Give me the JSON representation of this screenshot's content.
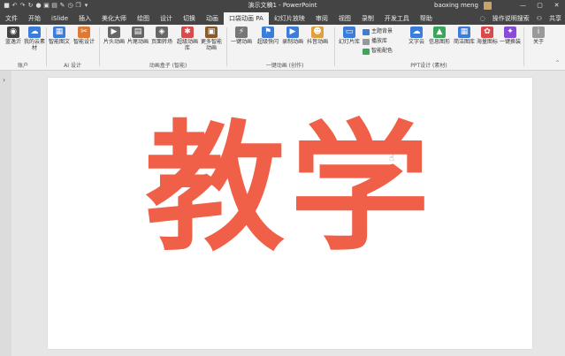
{
  "window": {
    "title": "演示文稿1 - PowerPoint",
    "user_name": "baoxing meng",
    "controls": [
      "—",
      "▢",
      "✕"
    ]
  },
  "tabs": [
    "文件",
    "开始",
    "iSlide",
    "插入",
    "美化大师",
    "绘图",
    "设计",
    "切换",
    "动画",
    "口袋动画 PA",
    "幻灯片放映",
    "审阅",
    "视图",
    "录制",
    "开发工具",
    "帮助"
  ],
  "active_tab": "口袋动画 PA",
  "tabs_right": {
    "search": "操作说明搜索",
    "share": "共享"
  },
  "ribbon": {
    "buttons": [
      {
        "label": "蓝逸沂",
        "icon": "avatar-icon",
        "color": "#444444"
      },
      {
        "label": "我的云素材",
        "icon": "cloud-icon",
        "color": "#3b7dd8"
      },
      {
        "label": "智能图文",
        "icon": "smart-text-icon",
        "color": "#3b7dd8"
      },
      {
        "label": "智能设计",
        "icon": "smart-design-icon",
        "color": "#e07a33"
      },
      {
        "label": "片头动画",
        "icon": "intro-anim-icon",
        "color": "#666666"
      },
      {
        "label": "片尾动画",
        "icon": "outro-anim-icon",
        "color": "#666666"
      },
      {
        "label": "页面转场",
        "icon": "transition-icon",
        "color": "#666666"
      },
      {
        "label": "超级动画库",
        "icon": "anim-lib-icon",
        "color": "#d94a4a"
      },
      {
        "label": "更多智能动画",
        "icon": "more-anim-icon",
        "color": "#8a5a2b"
      },
      {
        "label": "一键动画",
        "icon": "one-click-anim-icon",
        "color": "#777777"
      },
      {
        "label": "超级快闪",
        "icon": "flash-icon",
        "color": "#3b7dd8"
      },
      {
        "label": "录制动画",
        "icon": "record-anim-icon",
        "color": "#3b7dd8"
      },
      {
        "label": "抖音动画",
        "icon": "tiktok-anim-icon",
        "color": "#e0a040"
      },
      {
        "label": "幻灯片库",
        "icon": "slide-lib-icon",
        "color": "#3b7dd8"
      },
      {
        "label": "文字云",
        "icon": "word-cloud-icon",
        "color": "#3b7dd8"
      },
      {
        "label": "信息图形",
        "icon": "infographic-icon",
        "color": "#3aa65b"
      },
      {
        "label": "简洁图库",
        "icon": "image-lib-icon",
        "color": "#3b7dd8"
      },
      {
        "label": "海量图标",
        "icon": "icon-lib-icon",
        "color": "#d94a4a"
      },
      {
        "label": "一键换装",
        "icon": "reskin-icon",
        "color": "#8a4ad9"
      },
      {
        "label": "关于",
        "icon": "about-icon",
        "color": "#999999"
      }
    ],
    "small_buttons": [
      {
        "label": "主题背景",
        "icon": "theme-bg-icon"
      },
      {
        "label": "播放库",
        "icon": "play-lib-icon"
      },
      {
        "label": "智能配色",
        "icon": "color-match-icon"
      }
    ],
    "groups": [
      "账户",
      "AI 设计",
      "动画盒子 (智能)",
      "一键动画 (创作)",
      "PPT设计 (素材)"
    ]
  },
  "slide": {
    "text": "教学",
    "color": "#f06048"
  }
}
